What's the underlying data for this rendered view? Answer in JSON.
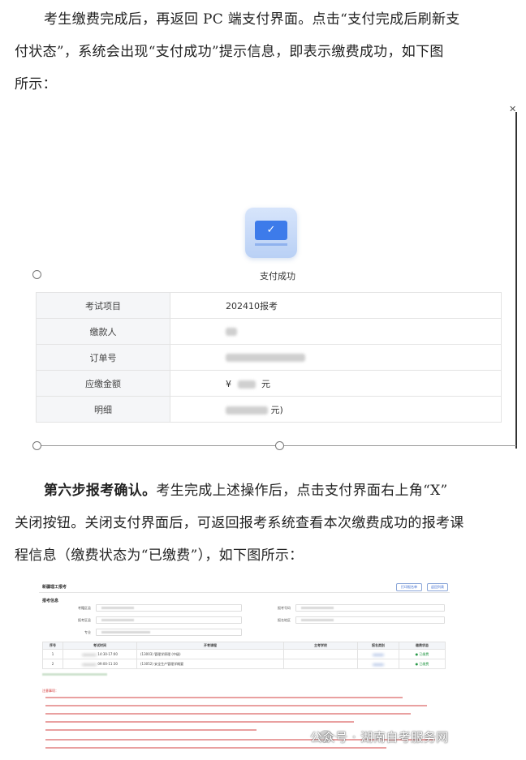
{
  "intro": {
    "line1": "考生缴费完成后，再返回 PC 端支付界面。点击“支付完成后刷新支",
    "line2": "付状态”，系统会出现“支付成功”提示信息，即表示缴费成功，如下图",
    "line3": "所示："
  },
  "payment_screen": {
    "close_icon_glyph": "✕",
    "success_icon": "card-check-icon",
    "success_text": "支付成功",
    "rows": [
      {
        "key": "考试项目",
        "value": "202410报考"
      },
      {
        "key": "缴款人",
        "value": ""
      },
      {
        "key": "订单号",
        "value": ""
      },
      {
        "key": "应缴金额",
        "value_prefix": "¥",
        "value_suffix": "元"
      },
      {
        "key": "明细",
        "value_suffix": "元)"
      }
    ]
  },
  "step6": {
    "bold": "第六步报考确认。",
    "line1": "考生完成上述操作后，点击支付界面右上角“X”",
    "line2": "关闭按钮。关闭支付界面后，可返回报考系统查看本次缴费成功的报考课",
    "line3": "程信息（缴费状态为“已缴费”），如下图所示："
  },
  "registration_screen": {
    "title": "新疆理工报考",
    "btn_a": "打印报名单",
    "btn_b": "返回列表",
    "section": "报考信息",
    "fields": {
      "exam_site": "考籍区县",
      "report_site": "报考区县",
      "major": "专业",
      "exam_no": "报考号码",
      "region": "报名地区"
    },
    "table": {
      "headers": [
        "序号",
        "考试时间",
        "",
        "开考课程",
        "主考学校",
        "报名类别",
        "缴费状态"
      ],
      "rows": [
        {
          "no": "1",
          "time": "14:30-17:00",
          "course": "(13003) 管理学原理 (中级)",
          "status": "已缴费"
        },
        {
          "no": "2",
          "time": "09:00-11:30",
          "course": "(13052) 安全生产管理学概要",
          "status": "已缴费"
        }
      ]
    },
    "notice_title": "注意事项："
  },
  "watermark": "公众号 · 湖南自考服务网"
}
